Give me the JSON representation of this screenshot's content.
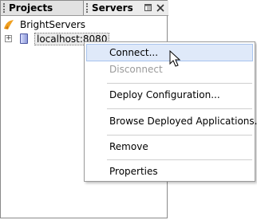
{
  "tabs": {
    "projects": "Projects",
    "servers": "Servers"
  },
  "tree": {
    "root": "BrightServers",
    "server": "localhost:8080",
    "expander_symbol": "+"
  },
  "context_menu": {
    "items": [
      {
        "label": "Connect...",
        "enabled": true,
        "hovered": true
      },
      {
        "label": "Disconnect",
        "enabled": false
      },
      {
        "label": "Deploy Configuration...",
        "enabled": true
      },
      {
        "label": "Browse Deployed Applications...",
        "enabled": true
      },
      {
        "label": "Remove",
        "enabled": true
      },
      {
        "label": "Properties",
        "enabled": true
      }
    ]
  },
  "icons": {
    "tab_restore": "restore-icon",
    "tab_close": "close-icon",
    "root": "folder-icon",
    "server": "server-icon"
  },
  "colors": {
    "hover_bg": "#dfe9f9",
    "disabled_text": "#9a9a9a"
  }
}
